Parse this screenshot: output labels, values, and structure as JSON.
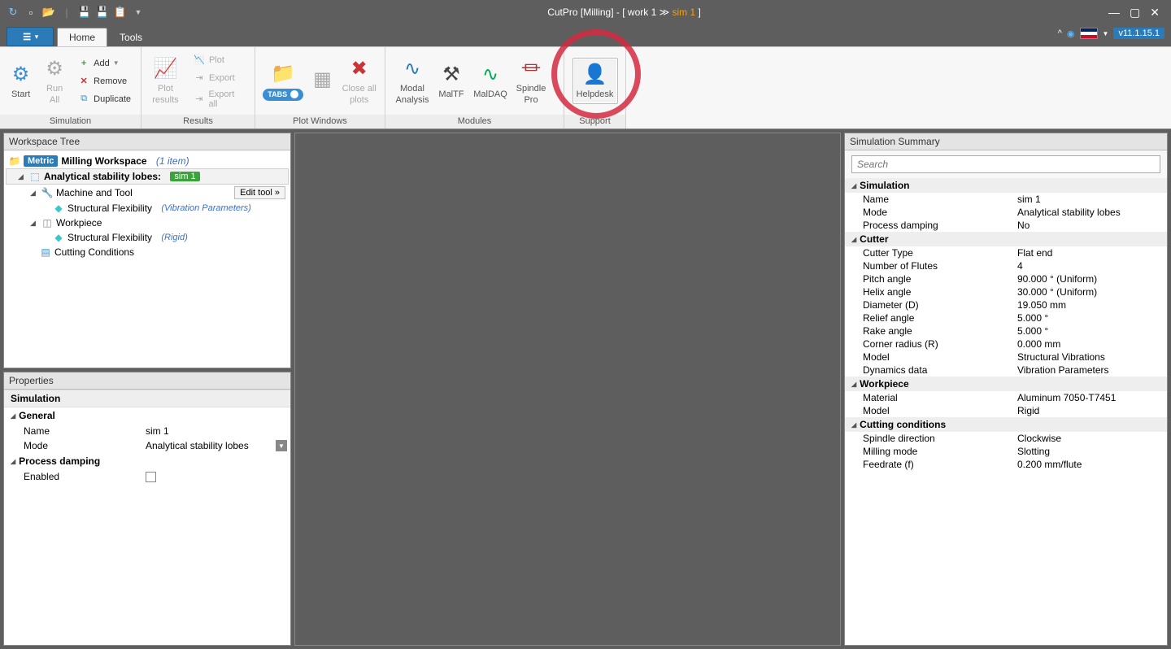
{
  "title": {
    "app": "CutPro [Milling]",
    "doc": "work 1",
    "sim": "sim 1"
  },
  "version": "v11.1.15.1",
  "tabs": {
    "home": "Home",
    "tools": "Tools"
  },
  "ribbon": {
    "simulation": {
      "label": "Simulation",
      "start": "Start",
      "runAll": "Run All",
      "add": "Add",
      "remove": "Remove",
      "duplicate": "Duplicate"
    },
    "results": {
      "label": "Results",
      "plotResults": "Plot results",
      "plot": "Plot",
      "export": "Export",
      "exportAll": "Export all"
    },
    "plotWindows": {
      "label": "Plot Windows",
      "tabs": "TABS",
      "closeAll": "Close all plots"
    },
    "modules": {
      "label": "Modules",
      "modal": "Modal Analysis",
      "maltf": "MalTF",
      "maldaq": "MalDAQ",
      "spindle": "Spindle Pro"
    },
    "support": {
      "label": "Support",
      "helpdesk": "Helpdesk"
    }
  },
  "panels": {
    "workspaceTree": "Workspace Tree",
    "properties": "Properties",
    "summary": "Simulation Summary"
  },
  "tree": {
    "metric": "Metric",
    "workspace": "Milling Workspace",
    "count": "(1 item)",
    "analytical": "Analytical stability lobes:",
    "simBadge": "sim 1",
    "machineTool": "Machine and Tool",
    "editTool": "Edit tool",
    "structFlex": "Structural Flexibility",
    "vibParams": "(Vibration Parameters)",
    "workpiece": "Workpiece",
    "rigid": "(Rigid)",
    "cutting": "Cutting Conditions"
  },
  "props": {
    "head": "Simulation",
    "general": "General",
    "name": {
      "k": "Name",
      "v": "sim 1"
    },
    "mode": {
      "k": "Mode",
      "v": "Analytical stability lobes"
    },
    "procDamp": "Process damping",
    "enabled": "Enabled"
  },
  "summary": {
    "searchPlaceholder": "Search",
    "simulation": {
      "cat": "Simulation",
      "rows": [
        {
          "k": "Name",
          "v": "sim 1"
        },
        {
          "k": "Mode",
          "v": "Analytical stability lobes"
        },
        {
          "k": "Process damping",
          "v": "No"
        }
      ]
    },
    "cutter": {
      "cat": "Cutter",
      "rows": [
        {
          "k": "Cutter Type",
          "v": "Flat end"
        },
        {
          "k": "Number of Flutes",
          "v": "4"
        },
        {
          "k": "Pitch angle",
          "v": "90.000 ° (Uniform)"
        },
        {
          "k": "Helix angle",
          "v": "30.000 ° (Uniform)"
        },
        {
          "k": "Diameter (D)",
          "v": "19.050 mm"
        },
        {
          "k": "Relief angle",
          "v": "5.000 °"
        },
        {
          "k": "Rake angle",
          "v": "5.000 °"
        },
        {
          "k": "Corner radius (R)",
          "v": "0.000 mm"
        },
        {
          "k": "Model",
          "v": "Structural Vibrations"
        },
        {
          "k": "Dynamics data",
          "v": "Vibration Parameters"
        }
      ]
    },
    "workpiece": {
      "cat": "Workpiece",
      "rows": [
        {
          "k": "Material",
          "v": "Aluminum 7050-T7451"
        },
        {
          "k": "Model",
          "v": "Rigid"
        }
      ]
    },
    "cutting": {
      "cat": "Cutting conditions",
      "rows": [
        {
          "k": "Spindle direction",
          "v": "Clockwise"
        },
        {
          "k": "Milling mode",
          "v": "Slotting"
        },
        {
          "k": "Feedrate (f)",
          "v": "0.200 mm/flute"
        }
      ]
    }
  }
}
